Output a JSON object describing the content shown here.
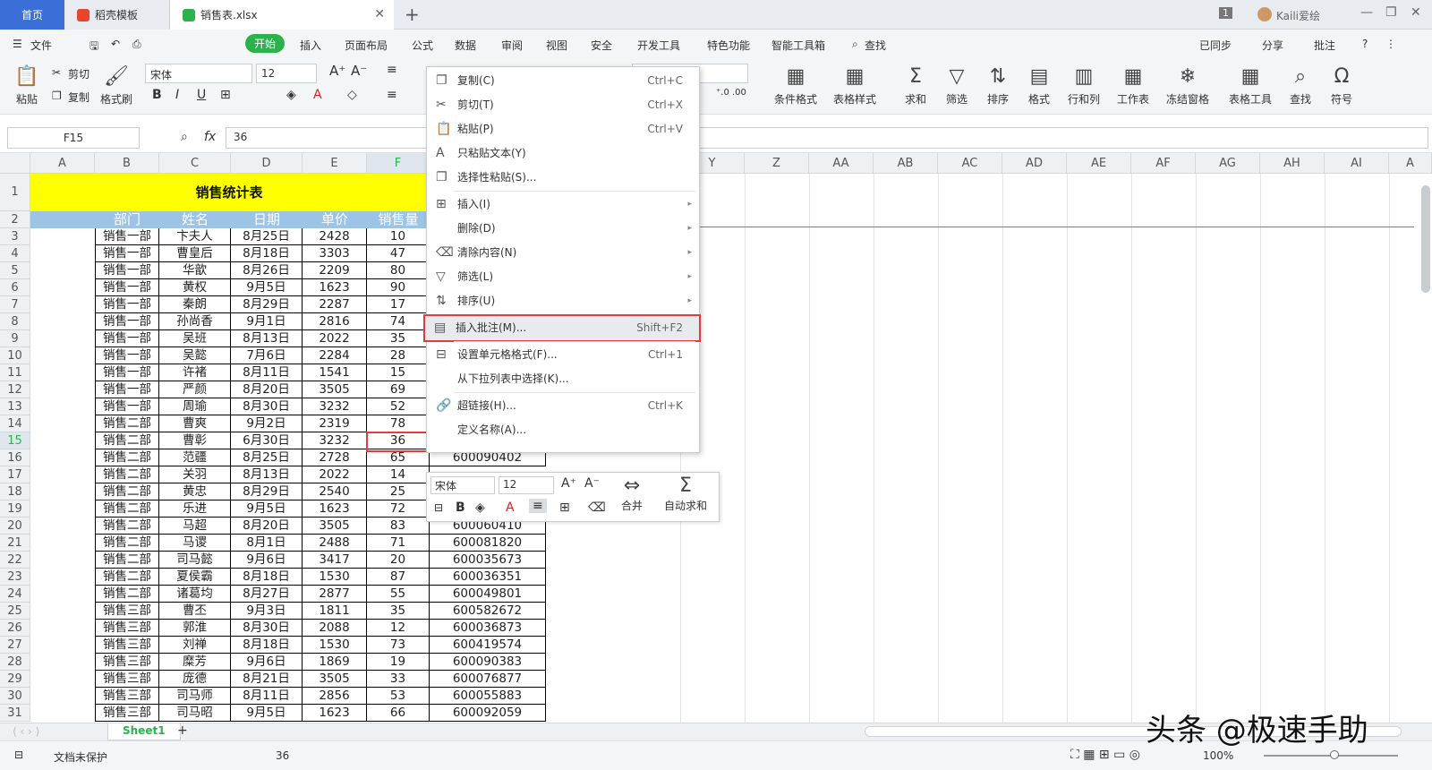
{
  "tabs": [
    {
      "label": "首页"
    },
    {
      "label": "稻壳模板"
    },
    {
      "label": "销售表.xlsx"
    }
  ],
  "window": {
    "badge": "1",
    "user": "Kaili爱绘"
  },
  "menu": {
    "file": "文件",
    "items": [
      "开始",
      "插入",
      "页面布局",
      "公式",
      "数据",
      "审阅",
      "视图",
      "安全",
      "开发工具",
      "特色功能",
      "智能工具箱"
    ],
    "search": "查找",
    "sync": "已同步",
    "share": "分享",
    "comment": "批注"
  },
  "ribbon": {
    "paste": "粘贴",
    "cut": "剪切",
    "copy": "复制",
    "format_painter": "格式刷",
    "font": "宋体",
    "size": "12",
    "cond_format": "条件格式",
    "table_style": "表格样式",
    "sum": "求和",
    "filter": "筛选",
    "sort": "排序",
    "format": "格式",
    "rowcol": "行和列",
    "worksheet": "工作表",
    "freeze": "冻结窗格",
    "table_tools": "表格工具",
    "find": "查找",
    "symbol": "符号"
  },
  "formula": {
    "cell_ref": "F15",
    "fx": "fx",
    "value": "36"
  },
  "columns": [
    "A",
    "B",
    "C",
    "D",
    "E",
    "F",
    "Y",
    "Z",
    "AA",
    "AB",
    "AC",
    "AD",
    "AE",
    "AF",
    "AG",
    "AH",
    "AI",
    "A"
  ],
  "sheet": {
    "title": "销售统计表",
    "headers": [
      "部门",
      "姓名",
      "日期",
      "单价",
      "销售量"
    ],
    "rows": [
      {
        "n": "3",
        "dept": "销售一部",
        "name": "卞夫人",
        "date": "8月25日",
        "price": "2428",
        "qty": "10",
        "code": ""
      },
      {
        "n": "4",
        "dept": "销售一部",
        "name": "曹皇后",
        "date": "8月18日",
        "price": "3303",
        "qty": "47",
        "code": ""
      },
      {
        "n": "5",
        "dept": "销售一部",
        "name": "华歆",
        "date": "8月26日",
        "price": "2209",
        "qty": "80",
        "code": ""
      },
      {
        "n": "6",
        "dept": "销售一部",
        "name": "黄权",
        "date": "9月5日",
        "price": "1623",
        "qty": "90",
        "code": ""
      },
      {
        "n": "7",
        "dept": "销售一部",
        "name": "秦朗",
        "date": "8月29日",
        "price": "2287",
        "qty": "17",
        "code": ""
      },
      {
        "n": "8",
        "dept": "销售一部",
        "name": "孙尚香",
        "date": "9月1日",
        "price": "2816",
        "qty": "74",
        "code": ""
      },
      {
        "n": "9",
        "dept": "销售一部",
        "name": "吴班",
        "date": "8月13日",
        "price": "2022",
        "qty": "35",
        "code": ""
      },
      {
        "n": "10",
        "dept": "销售一部",
        "name": "吴懿",
        "date": "7月6日",
        "price": "2284",
        "qty": "28",
        "code": ""
      },
      {
        "n": "11",
        "dept": "销售一部",
        "name": "许褚",
        "date": "8月11日",
        "price": "1541",
        "qty": "15",
        "code": ""
      },
      {
        "n": "12",
        "dept": "销售一部",
        "name": "严颜",
        "date": "8月20日",
        "price": "3505",
        "qty": "69",
        "code": ""
      },
      {
        "n": "13",
        "dept": "销售一部",
        "name": "周瑜",
        "date": "8月30日",
        "price": "3232",
        "qty": "52",
        "code": ""
      },
      {
        "n": "14",
        "dept": "销售二部",
        "name": "曹爽",
        "date": "9月2日",
        "price": "2319",
        "qty": "78",
        "code": ""
      },
      {
        "n": "15",
        "dept": "销售二部",
        "name": "曹彰",
        "date": "6月30日",
        "price": "3232",
        "qty": "36",
        "code": ""
      },
      {
        "n": "16",
        "dept": "销售二部",
        "name": "范疆",
        "date": "8月25日",
        "price": "2728",
        "qty": "65",
        "code": "600090402"
      },
      {
        "n": "17",
        "dept": "销售二部",
        "name": "关羽",
        "date": "8月13日",
        "price": "2022",
        "qty": "14",
        "code": ""
      },
      {
        "n": "18",
        "dept": "销售二部",
        "name": "黄忠",
        "date": "8月29日",
        "price": "2540",
        "qty": "25",
        "code": ""
      },
      {
        "n": "19",
        "dept": "销售二部",
        "name": "乐进",
        "date": "9月5日",
        "price": "1623",
        "qty": "72",
        "code": ""
      },
      {
        "n": "20",
        "dept": "销售二部",
        "name": "马超",
        "date": "8月20日",
        "price": "3505",
        "qty": "83",
        "code": "600060410"
      },
      {
        "n": "21",
        "dept": "销售二部",
        "name": "马谡",
        "date": "8月1日",
        "price": "2488",
        "qty": "71",
        "code": "600081820"
      },
      {
        "n": "22",
        "dept": "销售二部",
        "name": "司马懿",
        "date": "9月6日",
        "price": "3417",
        "qty": "20",
        "code": "600035673"
      },
      {
        "n": "23",
        "dept": "销售二部",
        "name": "夏侯霸",
        "date": "8月18日",
        "price": "1530",
        "qty": "87",
        "code": "600036351"
      },
      {
        "n": "24",
        "dept": "销售二部",
        "name": "诸葛均",
        "date": "8月27日",
        "price": "2877",
        "qty": "55",
        "code": "600049801"
      },
      {
        "n": "25",
        "dept": "销售三部",
        "name": "曹丕",
        "date": "9月3日",
        "price": "1811",
        "qty": "35",
        "code": "600582672"
      },
      {
        "n": "26",
        "dept": "销售三部",
        "name": "郭淮",
        "date": "8月30日",
        "price": "2088",
        "qty": "12",
        "code": "600036873"
      },
      {
        "n": "27",
        "dept": "销售三部",
        "name": "刘禅",
        "date": "8月18日",
        "price": "1530",
        "qty": "73",
        "code": "600419574"
      },
      {
        "n": "28",
        "dept": "销售三部",
        "name": "糜芳",
        "date": "9月6日",
        "price": "1869",
        "qty": "19",
        "code": "600090383"
      },
      {
        "n": "29",
        "dept": "销售三部",
        "name": "庞德",
        "date": "8月21日",
        "price": "3505",
        "qty": "33",
        "code": "600076877"
      },
      {
        "n": "30",
        "dept": "销售三部",
        "name": "司马师",
        "date": "8月11日",
        "price": "2856",
        "qty": "53",
        "code": "600055883"
      },
      {
        "n": "31",
        "dept": "销售三部",
        "name": "司马昭",
        "date": "9月5日",
        "price": "1623",
        "qty": "66",
        "code": "600092059"
      }
    ]
  },
  "context_menu": [
    {
      "label": "复制(C)",
      "shortcut": "Ctrl+C",
      "icon": "copy-icon",
      "glyph": "❐"
    },
    {
      "label": "剪切(T)",
      "shortcut": "Ctrl+X",
      "icon": "scissors-icon",
      "glyph": "✂"
    },
    {
      "label": "粘贴(P)",
      "shortcut": "Ctrl+V",
      "icon": "paste-icon",
      "glyph": "📋"
    },
    {
      "label": "只粘贴文本(Y)",
      "shortcut": "",
      "icon": "paste-text-icon",
      "glyph": "A"
    },
    {
      "label": "选择性粘贴(S)...",
      "shortcut": "",
      "icon": "paste-special-icon",
      "glyph": "❐"
    },
    {
      "label": "插入(I)",
      "shortcut": "",
      "icon": "insert-icon",
      "glyph": "⊞",
      "sub": true
    },
    {
      "label": "删除(D)",
      "shortcut": "",
      "icon": "",
      "glyph": "",
      "sub": true
    },
    {
      "label": "清除内容(N)",
      "shortcut": "",
      "icon": "eraser-icon",
      "glyph": "⌫",
      "sub": true
    },
    {
      "label": "筛选(L)",
      "shortcut": "",
      "icon": "filter-icon",
      "glyph": "▽",
      "sub": true
    },
    {
      "label": "排序(U)",
      "shortcut": "",
      "icon": "sort-icon",
      "glyph": "⇅",
      "sub": true
    },
    {
      "label": "插入批注(M)...",
      "shortcut": "Shift+F2",
      "icon": "comment-icon",
      "glyph": "▤"
    },
    {
      "label": "设置单元格格式(F)...",
      "shortcut": "Ctrl+1",
      "icon": "format-cells-icon",
      "glyph": "⊟"
    },
    {
      "label": "从下拉列表中选择(K)...",
      "shortcut": "",
      "icon": "",
      "glyph": ""
    },
    {
      "label": "超链接(H)...",
      "shortcut": "Ctrl+K",
      "icon": "link-icon",
      "glyph": "🔗"
    },
    {
      "label": "定义名称(A)...",
      "shortcut": "",
      "icon": "",
      "glyph": ""
    }
  ],
  "mini_toolbar": {
    "font": "宋体",
    "size": "12",
    "merge": "合并",
    "autosum": "自动求和"
  },
  "sheet_tab": "Sheet1",
  "status": {
    "protect": "文档未保护",
    "value": "36",
    "zoom": "100%"
  },
  "watermark": "头条 @极速手助"
}
